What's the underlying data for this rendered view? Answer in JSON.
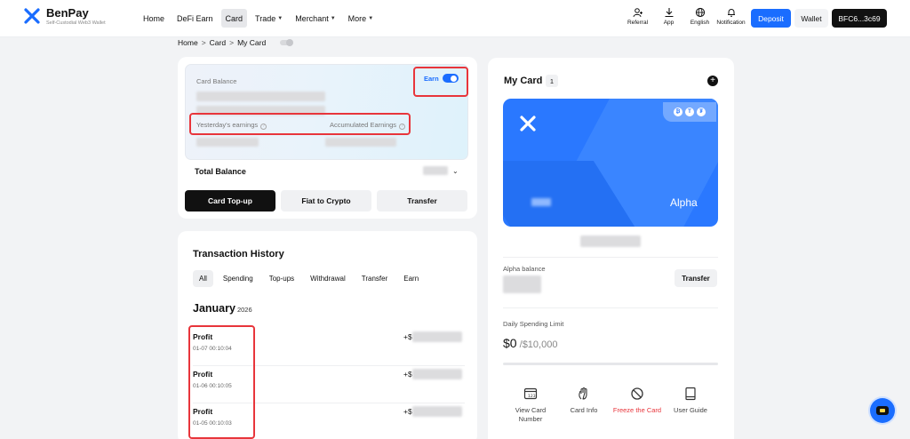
{
  "brand": {
    "name": "BenPay",
    "tagline": "Self-Custodial Web3 Wallet"
  },
  "nav": [
    {
      "label": "Home",
      "dropdown": false,
      "active": false
    },
    {
      "label": "DeFi Earn",
      "dropdown": false,
      "active": false
    },
    {
      "label": "Card",
      "dropdown": false,
      "active": true
    },
    {
      "label": "Trade",
      "dropdown": true,
      "active": false
    },
    {
      "label": "Merchant",
      "dropdown": true,
      "active": false
    },
    {
      "label": "More",
      "dropdown": true,
      "active": false
    }
  ],
  "tools": {
    "referral": "Referral",
    "app": "App",
    "english": "English",
    "notification": "Notification"
  },
  "header_buttons": {
    "deposit": "Deposit",
    "wallet": "Wallet",
    "account": "BFC6...3c69"
  },
  "breadcrumb": {
    "home": "Home",
    "card": "Card",
    "current": "My Card",
    "sep": ">"
  },
  "balance": {
    "card_balance_label": "Card Balance",
    "earn_label": "Earn",
    "earn_enabled": true,
    "yesterday_label": "Yesterday's earnings",
    "accumulated_label": "Accumulated Earnings",
    "total_balance_label": "Total Balance",
    "actions": {
      "topup": "Card Top-up",
      "fiat": "Fiat to Crypto",
      "transfer": "Transfer"
    }
  },
  "history": {
    "title": "Transaction History",
    "tabs": [
      "All",
      "Spending",
      "Top-ups",
      "Withdrawal",
      "Transfer",
      "Earn"
    ],
    "active_tab": "All",
    "month": "January",
    "year": "2026",
    "transactions": [
      {
        "type": "Profit",
        "time": "01-07 00:10:04",
        "amount_prefix": "+$"
      },
      {
        "type": "Profit",
        "time": "01-06 00:10:05",
        "amount_prefix": "+$"
      },
      {
        "type": "Profit",
        "time": "01-05 00:10:03",
        "amount_prefix": "+$"
      }
    ]
  },
  "my_card": {
    "title": "My Card",
    "count": "1",
    "card_name": "Alpha",
    "alpha_balance_label": "Alpha balance",
    "transfer_label": "Transfer",
    "limit_label": "Daily Spending Limit",
    "limit_spent": "$0",
    "limit_total": " /$10,000",
    "limit_progress": 0,
    "quick_actions": {
      "view": "View Card Number",
      "info": "Card Info",
      "freeze": "Freeze the Card",
      "guide": "User Guide"
    },
    "coin_symbols": [
      "₿",
      "T",
      "₮"
    ]
  },
  "colors": {
    "accent": "#1a6dff",
    "highlight": "#e8353b",
    "card": "#2a78ff"
  }
}
